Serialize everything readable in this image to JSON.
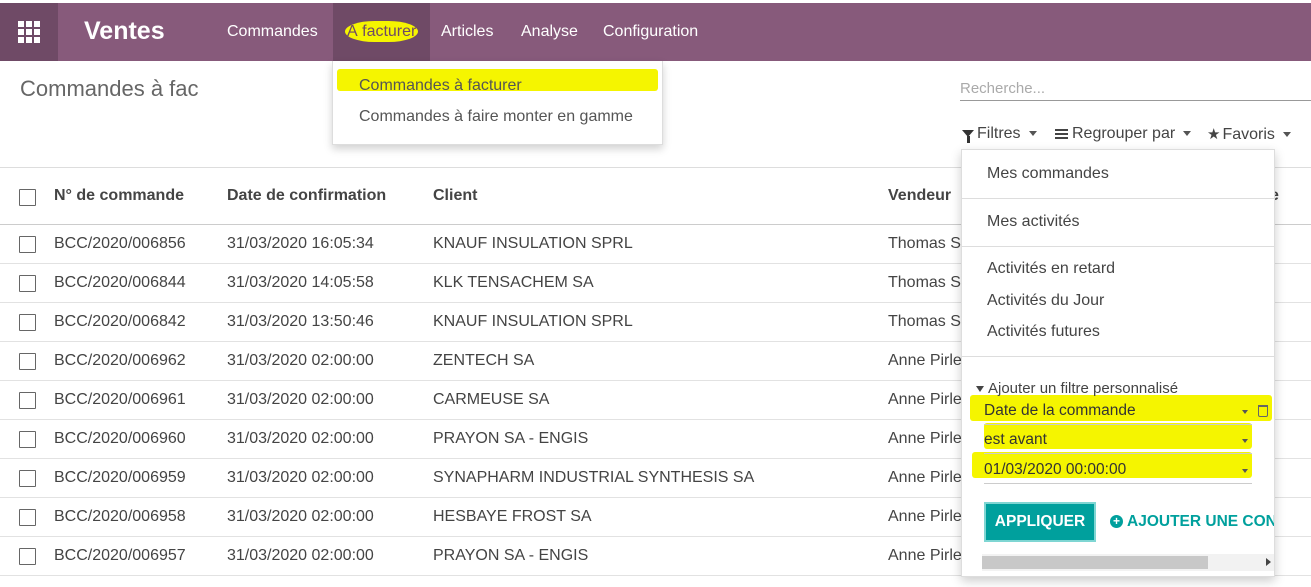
{
  "app": {
    "title": "Ventes",
    "apps_icon": "grid-icon"
  },
  "nav": {
    "items": [
      {
        "label": "Commandes"
      },
      {
        "label": "À facturer"
      },
      {
        "label": "Articles"
      },
      {
        "label": "Analyse"
      },
      {
        "label": "Configuration"
      }
    ],
    "dropdown": [
      {
        "label": "Commandes à facturer"
      },
      {
        "label": "Commandes à faire monter en gamme"
      }
    ]
  },
  "page": {
    "title": "Commandes à fac"
  },
  "search": {
    "placeholder": "Recherche..."
  },
  "controls": {
    "filters": "Filtres",
    "group_by": "Regrouper par",
    "favorites": "Favoris"
  },
  "table": {
    "columns": [
      "N° de commande",
      "Date de confirmation",
      "Client",
      "Vendeur",
      "e"
    ],
    "rows": [
      {
        "order": "BCC/2020/006856",
        "date": "31/03/2020 16:05:34",
        "client": "KNAUF INSULATION SPRL",
        "seller": "Thomas S"
      },
      {
        "order": "BCC/2020/006844",
        "date": "31/03/2020 14:05:58",
        "client": "KLK TENSACHEM SA",
        "seller": "Thomas S"
      },
      {
        "order": "BCC/2020/006842",
        "date": "31/03/2020 13:50:46",
        "client": "KNAUF INSULATION SPRL",
        "seller": "Thomas S"
      },
      {
        "order": "BCC/2020/006962",
        "date": "31/03/2020 02:00:00",
        "client": "ZENTECH SA",
        "seller": "Anne Pirle"
      },
      {
        "order": "BCC/2020/006961",
        "date": "31/03/2020 02:00:00",
        "client": "CARMEUSE SA",
        "seller": "Anne Pirle"
      },
      {
        "order": "BCC/2020/006960",
        "date": "31/03/2020 02:00:00",
        "client": "PRAYON SA - ENGIS",
        "seller": "Anne Pirle"
      },
      {
        "order": "BCC/2020/006959",
        "date": "31/03/2020 02:00:00",
        "client": "SYNAPHARM INDUSTRIAL SYNTHESIS SA",
        "seller": "Anne Pirle"
      },
      {
        "order": "BCC/2020/006958",
        "date": "31/03/2020 02:00:00",
        "client": "HESBAYE FROST SA",
        "seller": "Anne Pirle"
      },
      {
        "order": "BCC/2020/006957",
        "date": "31/03/2020 02:00:00",
        "client": "PRAYON SA - ENGIS",
        "seller": "Anne Pirle"
      }
    ]
  },
  "filters": {
    "groups": [
      [
        "Mes commandes"
      ],
      [
        "Mes activités"
      ],
      [
        "Activités en retard",
        "Activités du Jour",
        "Activités futures"
      ]
    ],
    "custom": {
      "toggle_label": "Ajouter un filtre personnalisé",
      "field": "Date de la commande",
      "operator": "est avant",
      "value": "01/03/2020 00:00:00",
      "apply": "APPLIQUER",
      "add": "AJOUTER UNE CONI"
    }
  },
  "colors": {
    "brand": "#875a7b",
    "brand_dark": "#6f4a66",
    "accent": "#00a09d",
    "highlight": "#f5f500"
  }
}
